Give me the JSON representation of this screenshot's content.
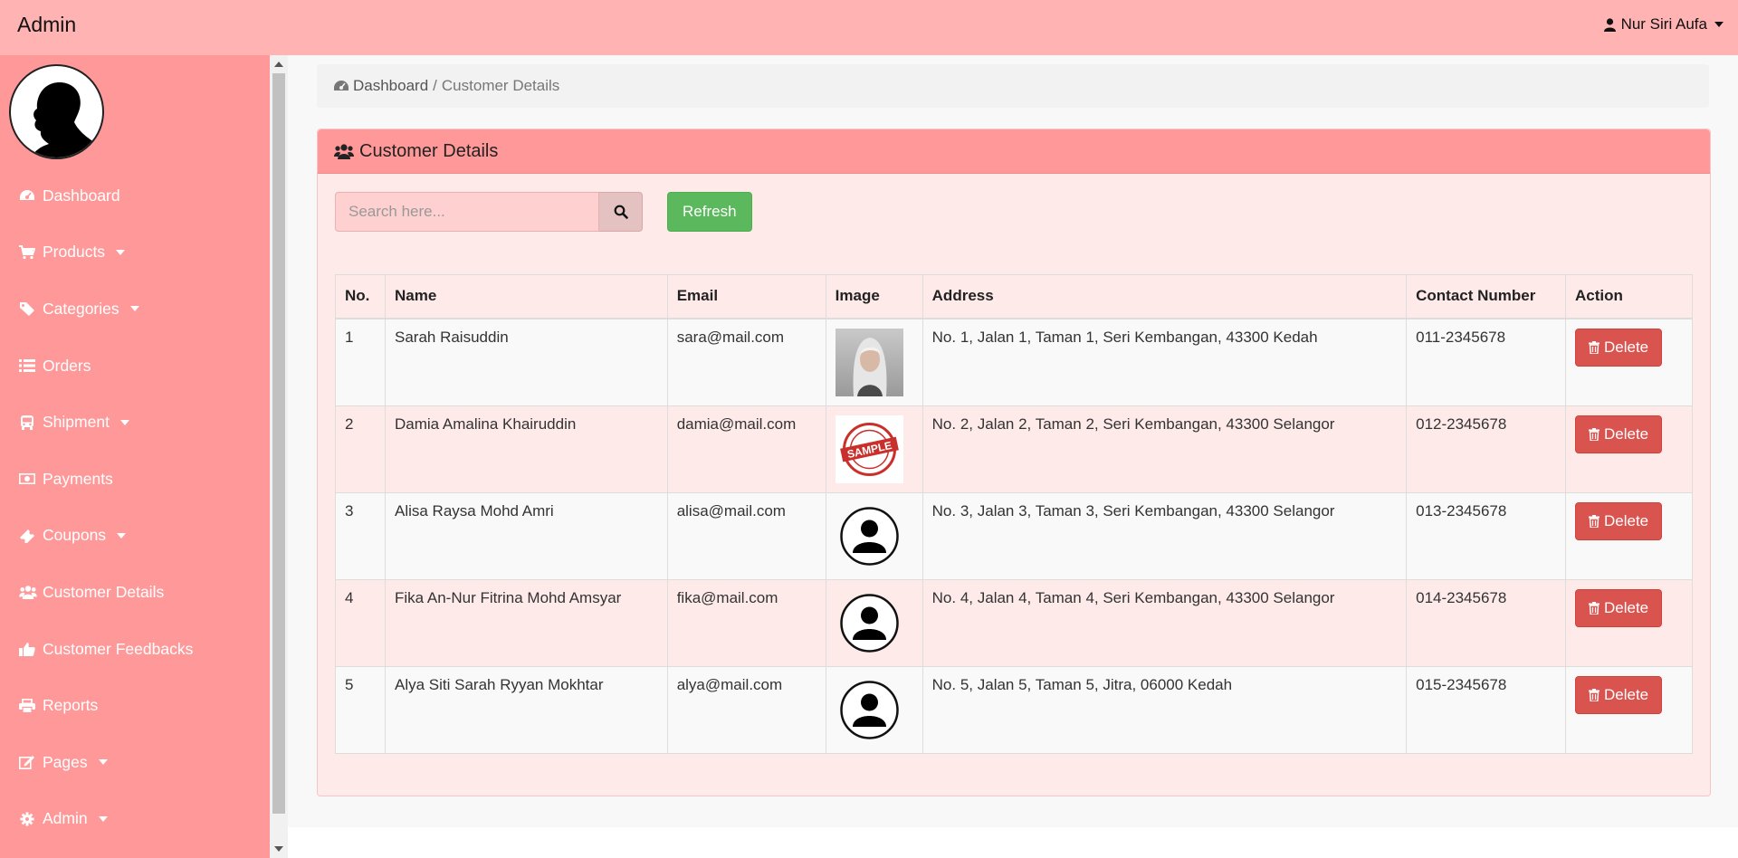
{
  "app": {
    "title": "Admin"
  },
  "user": {
    "name": "Nur Siri Aufa"
  },
  "sidebar": {
    "items": [
      {
        "label": "Dashboard",
        "icon": "dashboard-icon",
        "has_caret": false
      },
      {
        "label": "Products",
        "icon": "cart-icon",
        "has_caret": true
      },
      {
        "label": "Categories",
        "icon": "tag-icon",
        "has_caret": true
      },
      {
        "label": "Orders",
        "icon": "list-icon",
        "has_caret": false
      },
      {
        "label": "Shipment",
        "icon": "bus-icon",
        "has_caret": true
      },
      {
        "label": "Payments",
        "icon": "money-icon",
        "has_caret": false
      },
      {
        "label": "Coupons",
        "icon": "ticket-icon",
        "has_caret": true
      },
      {
        "label": "Customer Details",
        "icon": "users-icon",
        "has_caret": false
      },
      {
        "label": "Customer Feedbacks",
        "icon": "thumbs-up-icon",
        "has_caret": false
      },
      {
        "label": "Reports",
        "icon": "print-icon",
        "has_caret": false
      },
      {
        "label": "Pages",
        "icon": "edit-icon",
        "has_caret": true
      },
      {
        "label": "Admin",
        "icon": "gear-icon",
        "has_caret": true
      }
    ]
  },
  "breadcrumb": {
    "home": "Dashboard",
    "separator": "/",
    "current": "Customer Details"
  },
  "panel": {
    "title": "Customer Details"
  },
  "search": {
    "placeholder": "Search here..."
  },
  "buttons": {
    "refresh": "Refresh",
    "delete": "Delete"
  },
  "table": {
    "headers": [
      "No.",
      "Name",
      "Email",
      "Image",
      "Address",
      "Contact Number",
      "Action"
    ],
    "rows": [
      {
        "no": "1",
        "name": "Sarah Raisuddin",
        "email": "sara@mail.com",
        "image": "portrait-photo",
        "address": "No. 1, Jalan 1, Taman 1, Seri Kembangan, 43300 Kedah",
        "contact": "011-2345678"
      },
      {
        "no": "2",
        "name": "Damia Amalina Khairuddin",
        "email": "damia@mail.com",
        "image": "sample-stamp",
        "address": "No. 2, Jalan 2, Taman 2, Seri Kembangan, 43300 Selangor",
        "contact": "012-2345678"
      },
      {
        "no": "3",
        "name": "Alisa Raysa Mohd Amri",
        "email": "alisa@mail.com",
        "image": "default-avatar",
        "address": "No. 3, Jalan 3, Taman 3, Seri Kembangan, 43300 Selangor",
        "contact": "013-2345678"
      },
      {
        "no": "4",
        "name": "Fika An-Nur Fitrina Mohd Amsyar",
        "email": "fika@mail.com",
        "image": "default-avatar",
        "address": "No. 4, Jalan 4, Taman 4, Seri Kembangan, 43300 Selangor",
        "contact": "014-2345678"
      },
      {
        "no": "5",
        "name": "Alya Siti Sarah Ryyan Mokhtar",
        "email": "alya@mail.com",
        "image": "default-avatar",
        "address": "No. 5, Jalan 5, Taman 5, Jitra, 06000 Kedah",
        "contact": "015-2345678"
      }
    ]
  },
  "stamp_text": "SAMPLE",
  "colors": {
    "topbar": "#ffb3b3",
    "sidebar": "#ff9999",
    "panel_head": "#ff9999",
    "panel_body": "#ffeaea",
    "refresh": "#5cb85c",
    "delete": "#d9534f"
  }
}
